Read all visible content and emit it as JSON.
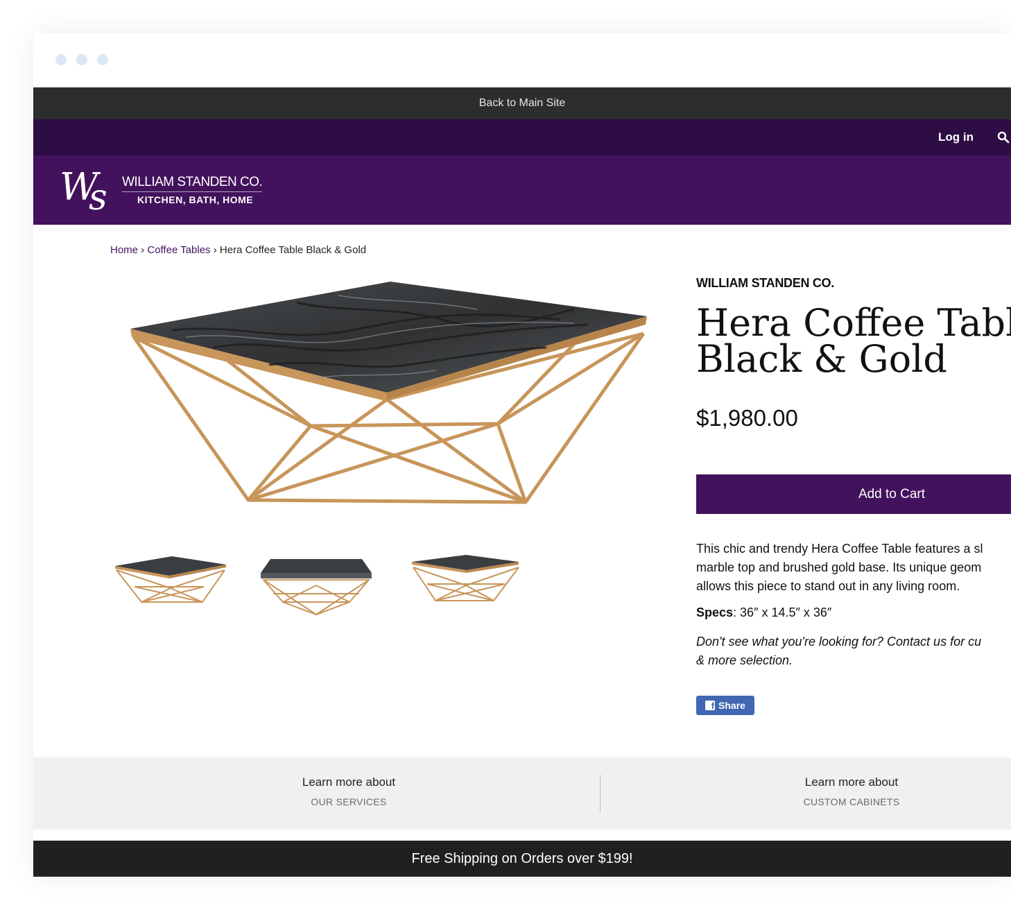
{
  "top_bar": {
    "back_link": "Back to Main Site"
  },
  "user_bar": {
    "login": "Log in"
  },
  "logo": {
    "name": "WILLIAM STANDEN CO.",
    "tagline": "KITCHEN, BATH, HOME",
    "monogram": "Ws"
  },
  "breadcrumb": {
    "home": "Home",
    "sep1": " › ",
    "category": "Coffee Tables",
    "sep2": " › ",
    "current": "Hera Coffee Table Black & Gold"
  },
  "product": {
    "brand": "WILLIAM STANDEN CO.",
    "title_line1": "Hera Coffee Table",
    "title_line2": "Black & Gold",
    "price": "$1,980.00",
    "add_to_cart": "Add to Cart",
    "description_line1": "This chic and trendy Hera Coffee Table features a sl",
    "description_line2": "marble top and brushed gold base. Its unique geom",
    "description_line3": "allows this piece to stand out in any living room.",
    "specs_label": "Specs",
    "specs_value": ": 36″ x 14.5″ x 36″",
    "note_line1": "Don't see what you're looking for? Contact us for cu",
    "note_line2": "& more selection.",
    "share": "Share"
  },
  "learn_more": [
    {
      "heading": "Learn more about",
      "link": "OUR SERVICES"
    },
    {
      "heading": "Learn more about",
      "link": "CUSTOM CABINETS"
    }
  ],
  "shipping_banner": "Free Shipping on Orders over $199!",
  "colors": {
    "header_purple": "#43125d",
    "user_bar": "#2e0c44",
    "top_bar": "#2d2d2d",
    "facebook": "#4267b2"
  }
}
